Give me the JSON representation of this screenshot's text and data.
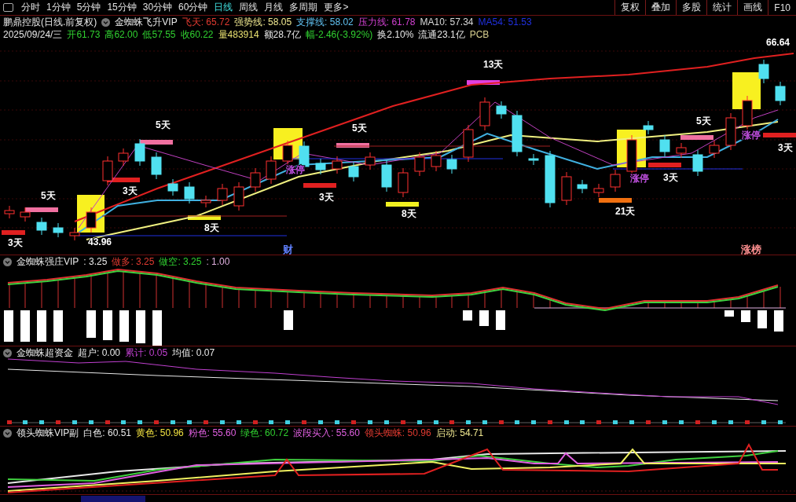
{
  "toolbar": {
    "tabs": [
      {
        "label": "分时",
        "selected": false
      },
      {
        "label": "1分钟",
        "selected": false
      },
      {
        "label": "5分钟",
        "selected": false
      },
      {
        "label": "15分钟",
        "selected": false
      },
      {
        "label": "30分钟",
        "selected": false
      },
      {
        "label": "60分钟",
        "selected": false
      },
      {
        "label": "日线",
        "selected": true
      },
      {
        "label": "周线",
        "selected": false
      },
      {
        "label": "月线",
        "selected": false
      },
      {
        "label": "多周期",
        "selected": false
      },
      {
        "label": "更多>",
        "selected": false
      }
    ],
    "buttons": [
      "复权",
      "叠加",
      "多股",
      "统计",
      "画线",
      "F10"
    ]
  },
  "main_panel": {
    "title": "鹏鼎控股(日线.前复权)",
    "indicator": "金蜘蛛飞升VIP",
    "readings": [
      {
        "text": "飞天: 65.72",
        "color": "#e03a30"
      },
      {
        "text": "强势线: 58.05",
        "color": "#f0e890"
      },
      {
        "text": "支撑线: 58.02",
        "color": "#60c0f0"
      },
      {
        "text": "压力线: 61.78",
        "color": "#d040d0"
      },
      {
        "text": "MA10: 57.34",
        "color": "#d8d8d8"
      },
      {
        "text": "MA54: 51.53",
        "color": "#2030e0"
      }
    ],
    "quote": [
      {
        "text": "2025/09/24/三",
        "color": "#e8e8e8"
      },
      {
        "text": "开61.73",
        "color": "#30d030"
      },
      {
        "text": "高62.00",
        "color": "#30d030"
      },
      {
        "text": "低57.55",
        "color": "#30d030"
      },
      {
        "text": "收60.22",
        "color": "#30d030"
      },
      {
        "text": "量483914",
        "color": "#e8e070"
      },
      {
        "text": "额28.7亿",
        "color": "#e8e8e8"
      },
      {
        "text": "幅-2.46(-3.92%)",
        "color": "#30d030"
      },
      {
        "text": "换2.10%",
        "color": "#e8e8e8"
      },
      {
        "text": "流通23.1亿",
        "color": "#e8e8e8"
      },
      {
        "text": "PCB",
        "color": "#d8d090"
      }
    ],
    "labels": [
      {
        "text": "5天",
        "color": "#ffffff"
      },
      {
        "text": "3天",
        "color": "#ffffff"
      },
      {
        "text": "43.96",
        "color": "#ffffff"
      },
      {
        "text": "5天",
        "color": "#ffffff"
      },
      {
        "text": "3天",
        "color": "#ffffff"
      },
      {
        "text": "8天",
        "color": "#ffffff"
      },
      {
        "text": "涨停",
        "color": "#c050e0"
      },
      {
        "text": "3天",
        "color": "#ffffff"
      },
      {
        "text": "5天",
        "color": "#ffffff"
      },
      {
        "text": "8天",
        "color": "#ffffff"
      },
      {
        "text": "13天",
        "color": "#ffffff"
      },
      {
        "text": "涨停",
        "color": "#c050e0"
      },
      {
        "text": "21天",
        "color": "#ffffff"
      },
      {
        "text": "3天",
        "color": "#ffffff"
      },
      {
        "text": "5天",
        "color": "#ffffff"
      },
      {
        "text": "涨停",
        "color": "#c050e0"
      },
      {
        "text": "3天",
        "color": "#ffffff"
      },
      {
        "text": "66.64",
        "color": "#ffffff"
      }
    ],
    "tags": [
      {
        "text": "财",
        "color": "#6080ff"
      },
      {
        "text": "涨榜",
        "color": "#ff9090"
      }
    ]
  },
  "panels": [
    {
      "kind": "histogram",
      "indicator": "金蜘蛛强庄VIP",
      "readings": [
        {
          "text": ": 3.25",
          "color": "#e8e8e8"
        },
        {
          "text": "做多: 3.25",
          "color": "#e03a30"
        },
        {
          "text": "做空: 3.25",
          "color": "#30d030"
        },
        {
          "text": ": 1.00",
          "color": "#e0b0e0"
        }
      ]
    },
    {
      "kind": "flow",
      "indicator": "金蜘蛛超资金",
      "readings": [
        {
          "text": "超户: 0.00",
          "color": "#e8e8e8"
        },
        {
          "text": "累计: 0.05",
          "color": "#c040d0"
        },
        {
          "text": "均值: 0.07",
          "color": "#e8e8e8"
        }
      ]
    },
    {
      "kind": "lines",
      "indicator": "领头蜘蛛VIP副",
      "readings": [
        {
          "text": "白色: 60.51",
          "color": "#e8e8e8"
        },
        {
          "text": "黄色: 50.96",
          "color": "#f0e040"
        },
        {
          "text": "粉色: 55.60",
          "color": "#e060e0"
        },
        {
          "text": "绿色: 60.72",
          "color": "#30d030"
        },
        {
          "text": "波段买入: 55.60",
          "color": "#e060e0"
        },
        {
          "text": "领头蜘蛛: 50.96",
          "color": "#e03a30"
        },
        {
          "text": "启动: 54.71",
          "color": "#f0e890"
        }
      ]
    }
  ]
}
